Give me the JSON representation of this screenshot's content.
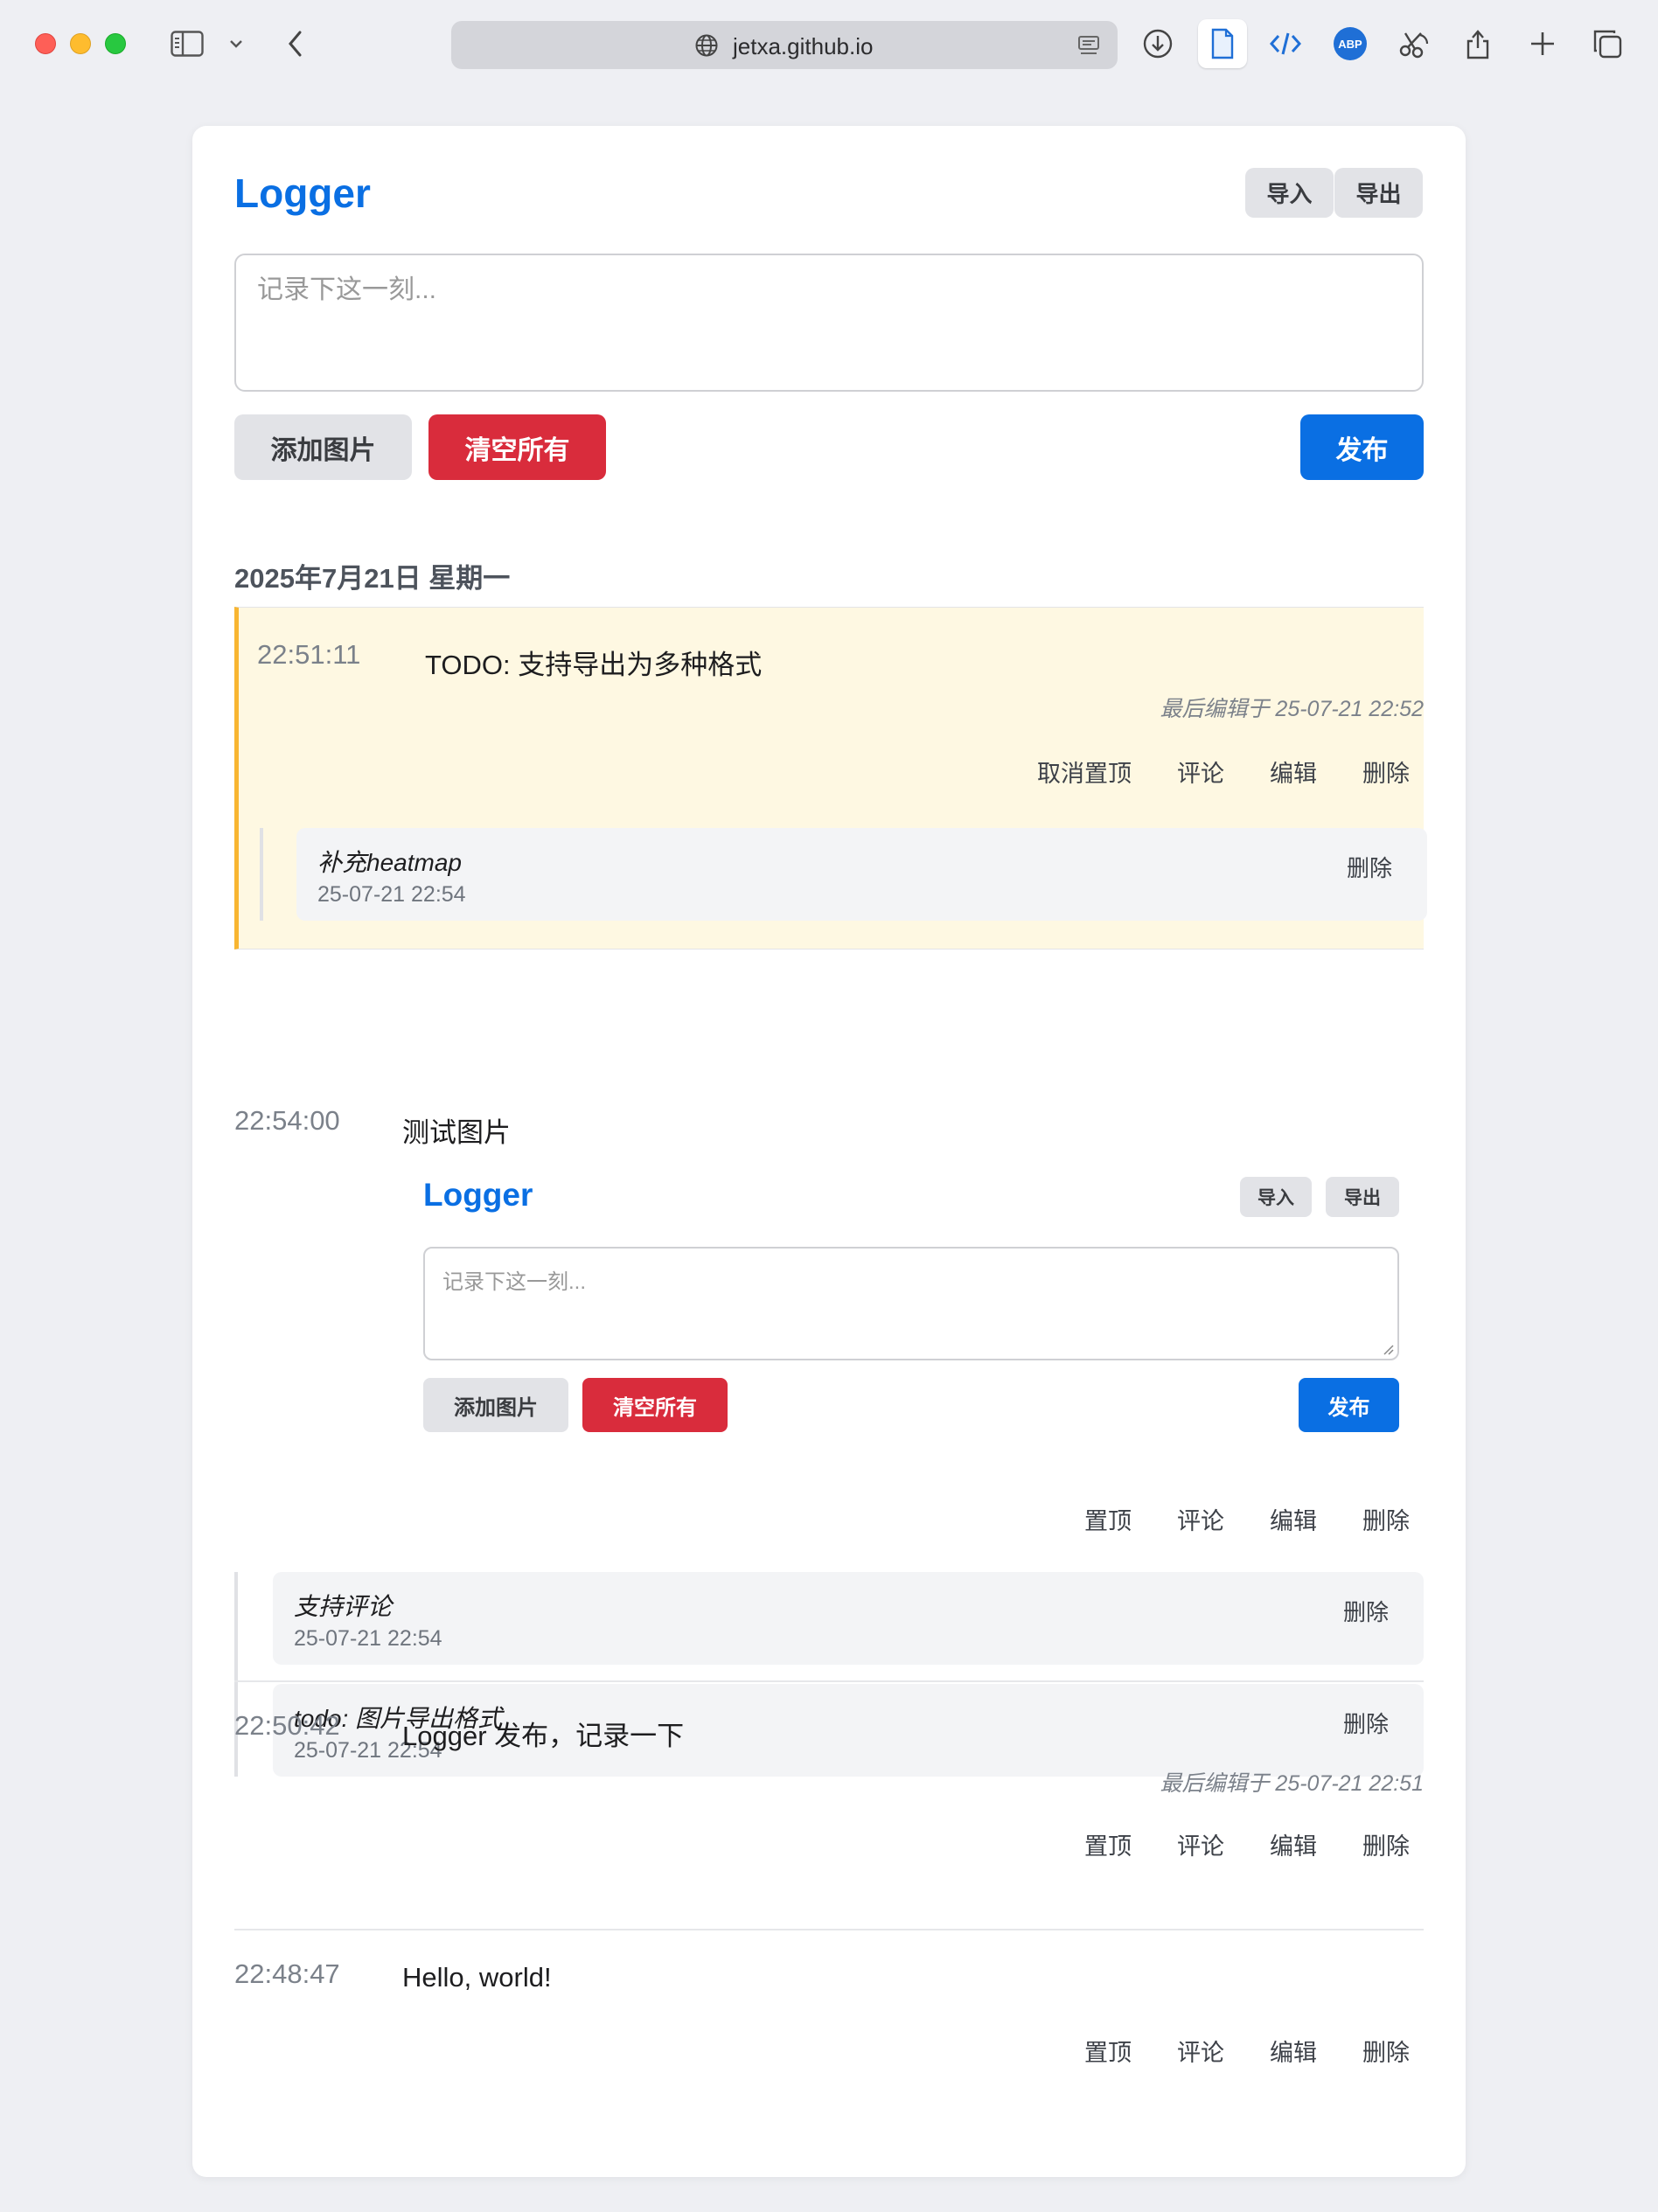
{
  "browser": {
    "url": "jetxa.github.io",
    "abp_label": "ABP"
  },
  "app": {
    "title": "Logger",
    "import_label": "导入",
    "export_label": "导出",
    "textarea_placeholder": "记录下这一刻...",
    "add_image_label": "添加图片",
    "clear_all_label": "清空所有",
    "publish_label": "发布",
    "date_heading": "2025年7月21日 星期一",
    "accent": "#0a6fe3",
    "danger": "#d92c3c",
    "pin_highlight": "#fef8e2"
  },
  "entries": [
    {
      "time": "22:51:11",
      "text": "TODO: 支持导出为多种格式",
      "edited": "最后编辑于 25-07-21 22:52",
      "actions": [
        "取消置顶",
        "评论",
        "编辑",
        "删除"
      ],
      "comments": [
        {
          "text": "补充heatmap",
          "date": "25-07-21 22:54",
          "delete": "删除"
        }
      ]
    },
    {
      "time": "22:54:00",
      "text": "测试图片",
      "image": {
        "title": "Logger",
        "import_label": "导入",
        "export_label": "导出",
        "placeholder": "记录下这一刻...",
        "add_image_label": "添加图片",
        "clear_all_label": "清空所有",
        "publish_label": "发布"
      },
      "actions": [
        "置顶",
        "评论",
        "编辑",
        "删除"
      ],
      "comments": [
        {
          "text": "支持评论",
          "date": "25-07-21 22:54",
          "delete": "删除"
        },
        {
          "text": "todo: 图片导出格式",
          "date": "25-07-21 22:54",
          "delete": "删除"
        }
      ]
    },
    {
      "time": "22:50:42",
      "text": "Logger 发布，记录一下",
      "edited": "最后编辑于 25-07-21 22:51",
      "actions": [
        "置顶",
        "评论",
        "编辑",
        "删除"
      ]
    },
    {
      "time": "22:48:47",
      "text": "Hello, world!",
      "actions": [
        "置顶",
        "评论",
        "编辑",
        "删除"
      ]
    }
  ]
}
